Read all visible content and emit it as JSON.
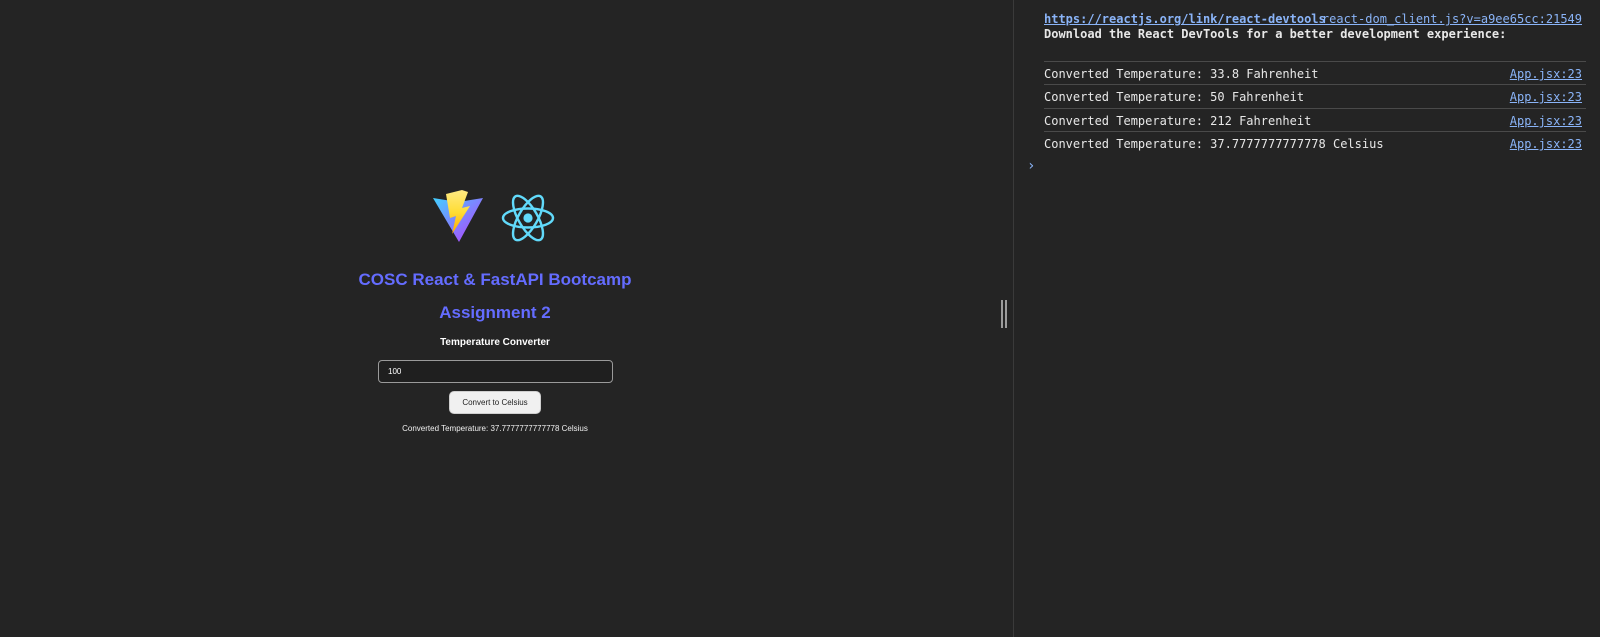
{
  "app": {
    "logos": [
      "vite-logo",
      "react-logo"
    ],
    "title_line1": "COSC React & FastAPI Bootcamp",
    "title_line2": "Assignment 2",
    "subtitle": "Temperature Converter",
    "input_value": "100",
    "button_label": "Convert to Celsius",
    "result_text": "Converted Temperature: 37.7777777777778 Celsius",
    "accent_color": "#646cff"
  },
  "console": {
    "devtools_source": "react-dom_client.js?v=a9ee65cc:21549",
    "devtools_message": "Download the React DevTools for a better development experience:",
    "devtools_link": "https://reactjs.org/link/react-devtools",
    "logs": [
      {
        "text": "Converted Temperature: 33.8 Fahrenheit",
        "source": "App.jsx:23"
      },
      {
        "text": "Converted Temperature: 50 Fahrenheit",
        "source": "App.jsx:23"
      },
      {
        "text": "Converted Temperature: 212 Fahrenheit",
        "source": "App.jsx:23"
      },
      {
        "text": "Converted Temperature: 37.7777777777778 Celsius",
        "source": "App.jsx:23"
      }
    ],
    "prompt_symbol": "›",
    "link_color": "#8ab4f8"
  }
}
